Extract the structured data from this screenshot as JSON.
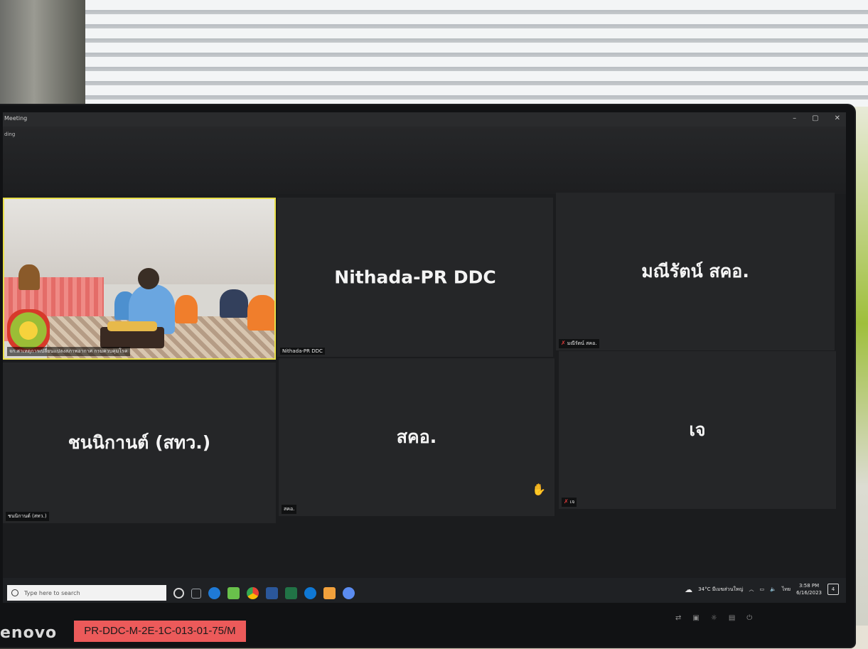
{
  "window": {
    "app_title": "Meeting",
    "recording_label": "ding",
    "controls": [
      "–",
      "▢",
      "✕"
    ]
  },
  "gallery": {
    "video_tile": {
      "name_label": "จก.สาเหตุการเปลี่ยนแปลงสภาพอากาศ กรมควบคุมโรค"
    },
    "tiles": [
      {
        "id": "nithada",
        "big_name": "Nithada-PR DDC",
        "small_name": "Nithada-PR DDC",
        "muted": false
      },
      {
        "id": "maneerat",
        "big_name": "มณีรัตน์ สคอ.",
        "small_name": "มณีรัตน์ สคอ.",
        "muted": true
      },
      {
        "id": "chanika",
        "big_name": "ชนนิกานต์ (สทว.)",
        "small_name": "ชนนิกานต์ (สทว.)",
        "muted": false
      },
      {
        "id": "sodo",
        "big_name": "สคอ.",
        "small_name": "สคอ.",
        "muted": false
      },
      {
        "id": "je",
        "big_name": "เจ",
        "small_name": "เจ",
        "muted": true
      }
    ]
  },
  "taskbar": {
    "search_placeholder": "Type here to search",
    "weather": "34°C มีเมฆส่วนใหญ่",
    "language": "ไทย",
    "time": "3:58 PM",
    "date": "6/16/2023",
    "notifications": "4",
    "app_icon_colors": [
      "#d9d9d9",
      "#9aa0a6",
      "#1f7ad6",
      "#69c14b",
      "#ea4335",
      "#2b579a",
      "#217346",
      "#0f78d4",
      "#f2a13c",
      "#5b8cf0"
    ]
  },
  "bezel": {
    "brand": "enovo",
    "asset_tag": "PR-DDC-M-2E-1C-013-01-75/M"
  }
}
